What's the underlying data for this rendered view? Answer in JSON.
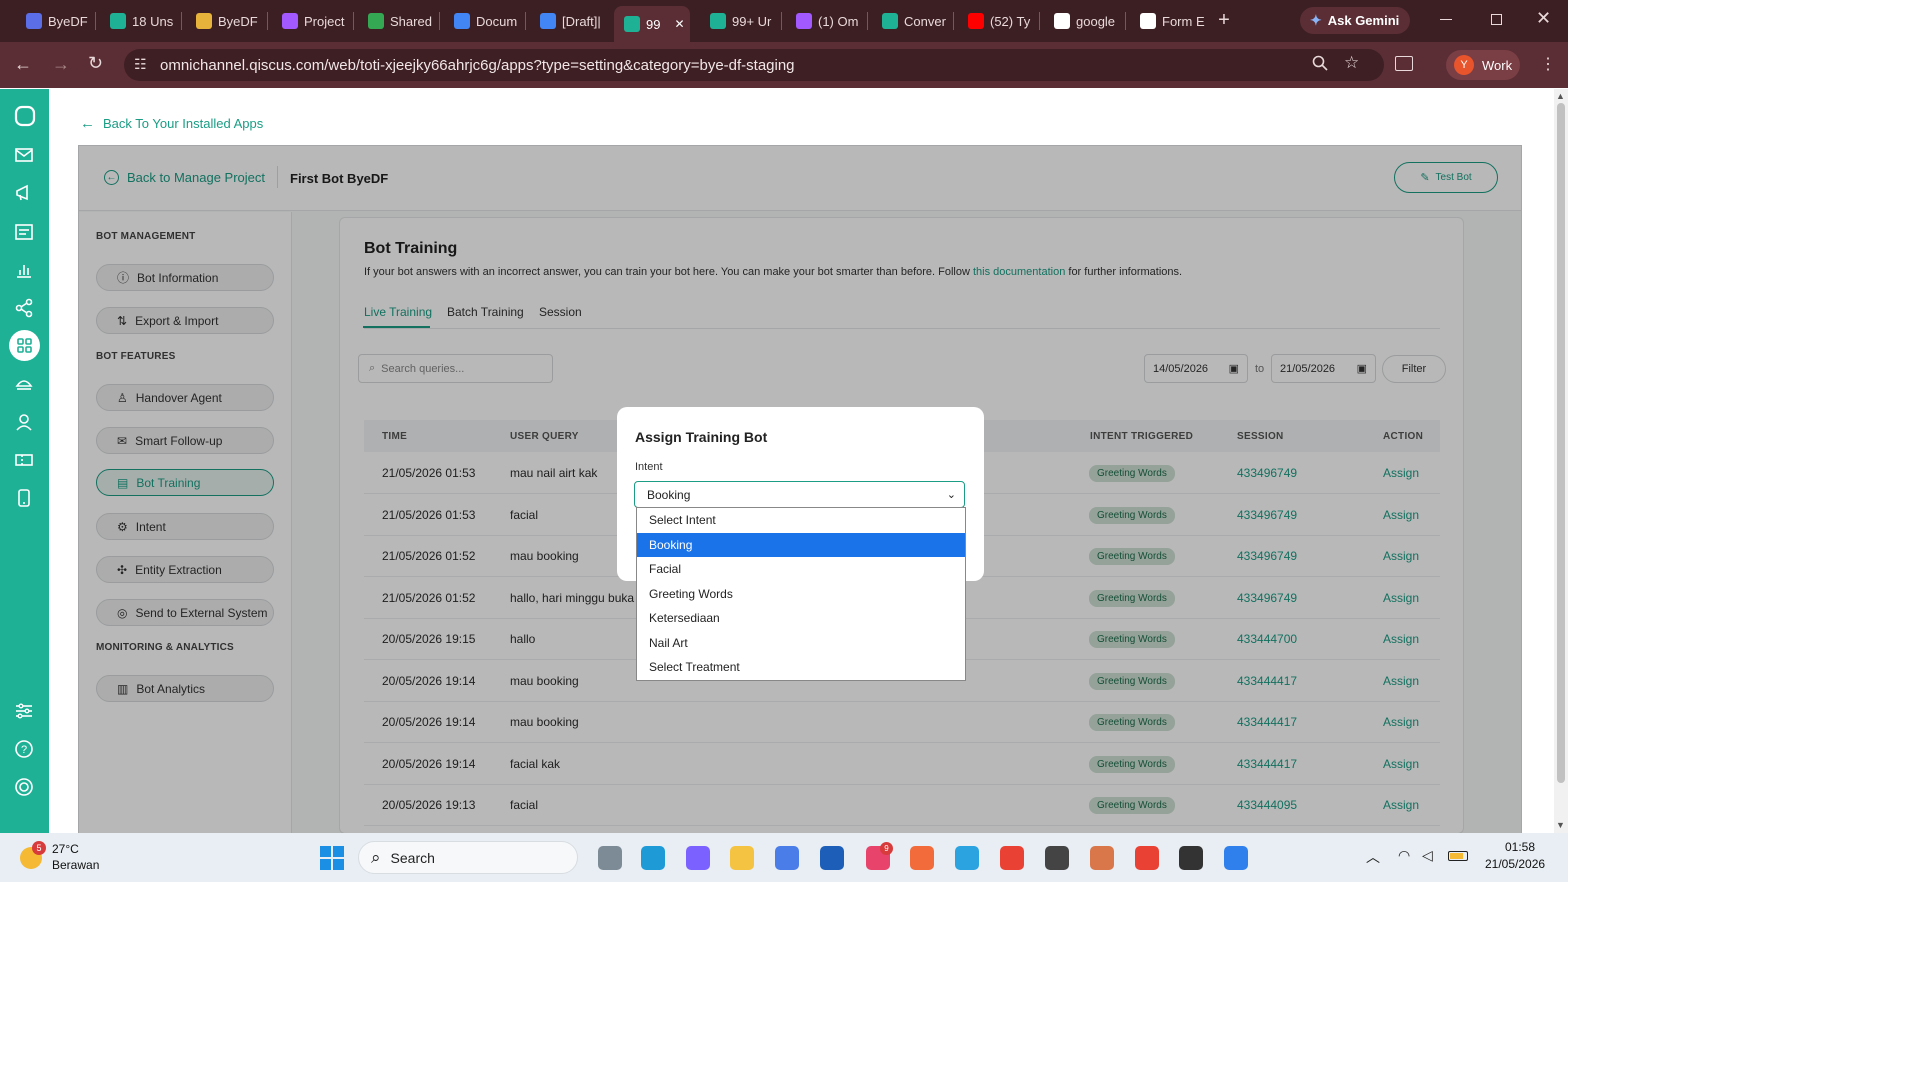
{
  "browser": {
    "tabs": [
      {
        "label": "ByeDF",
        "color": "#5b6ee8"
      },
      {
        "label": "18 Uns",
        "color": "#1fb196"
      },
      {
        "label": "ByeDF",
        "color": "#e8b33a"
      },
      {
        "label": "Project",
        "color": "#a259ff"
      },
      {
        "label": "Shared",
        "color": "#34a853"
      },
      {
        "label": "Docum",
        "color": "#4285f4"
      },
      {
        "label": "[Draft]|",
        "color": "#4285f4"
      },
      {
        "label": "99",
        "color": "#1fb196"
      },
      {
        "label": "99+ Ur",
        "color": "#1fb196"
      },
      {
        "label": "(1) Om",
        "color": "#a259ff"
      },
      {
        "label": "Conver",
        "color": "#1fb196"
      },
      {
        "label": "(52) Ty",
        "color": "#ff0000"
      },
      {
        "label": "google",
        "color": "#ffffff"
      },
      {
        "label": "Form E",
        "color": "#ffffff"
      }
    ],
    "ask_gemini": "Ask Gemini",
    "url": "omnichannel.qiscus.com/web/toti-xjeejky66ahrjc6g/apps?type=setting&category=bye-df-staging",
    "profile_initial": "Y",
    "profile_label": "Work"
  },
  "page": {
    "back_installed": "Back To Your Installed Apps",
    "back_manage": "Back to Manage Project",
    "bot_name": "First Bot ByeDF",
    "test_bot": "Test Bot"
  },
  "sidebar": {
    "heading_management": "BOT MANAGEMENT",
    "heading_features": "BOT FEATURES",
    "heading_monitoring": "MONITORING & ANALYTICS",
    "items": {
      "bot_information": "Bot Information",
      "export_import": "Export & Import",
      "handover_agent": "Handover Agent",
      "smart_followup": "Smart Follow-up",
      "bot_training": "Bot Training",
      "intent": "Intent",
      "entity_extraction": "Entity Extraction",
      "send_external": "Send to External System",
      "bot_analytics": "Bot Analytics"
    }
  },
  "training": {
    "title": "Bot Training",
    "desc_before": "If your bot answers with an incorrect answer, you can train your bot here. You can make your bot smarter than before. Follow ",
    "desc_link": "this documentation",
    "desc_after": " for further informations.",
    "tabs": [
      "Live Training",
      "Batch Training",
      "Session"
    ],
    "search_placeholder": "Search queries...",
    "date_from": "14/05/2026",
    "date_to": "21/05/2026",
    "to_label": "to",
    "filter": "Filter",
    "columns": {
      "time": "TIME",
      "query": "USER QUERY",
      "intent": "INTENT TRIGGERED",
      "session": "SESSION",
      "action": "ACTION"
    },
    "rows": [
      {
        "time": "21/05/2026 01:53",
        "query": "mau nail airt kak",
        "intent": "Greeting Words",
        "session": "433496749",
        "action": "Assign"
      },
      {
        "time": "21/05/2026 01:53",
        "query": "facial",
        "intent": "Greeting Words",
        "session": "433496749",
        "action": "Assign"
      },
      {
        "time": "21/05/2026 01:52",
        "query": "mau booking",
        "intent": "Greeting Words",
        "session": "433496749",
        "action": "Assign"
      },
      {
        "time": "21/05/2026 01:52",
        "query": "hallo, hari minggu buka g",
        "intent": "Greeting Words",
        "session": "433496749",
        "action": "Assign"
      },
      {
        "time": "20/05/2026 19:15",
        "query": "hallo",
        "intent": "Greeting Words",
        "session": "433444700",
        "action": "Assign"
      },
      {
        "time": "20/05/2026 19:14",
        "query": "mau booking",
        "intent": "Greeting Words",
        "session": "433444417",
        "action": "Assign"
      },
      {
        "time": "20/05/2026 19:14",
        "query": "mau booking",
        "intent": "Greeting Words",
        "session": "433444417",
        "action": "Assign"
      },
      {
        "time": "20/05/2026 19:14",
        "query": "facial kak",
        "intent": "Greeting Words",
        "session": "433444417",
        "action": "Assign"
      },
      {
        "time": "20/05/2026 19:13",
        "query": "facial",
        "intent": "Greeting Words",
        "session": "433444095",
        "action": "Assign"
      }
    ]
  },
  "modal": {
    "title": "Assign Training Bot",
    "intent_label": "Intent",
    "selected": "Booking",
    "options": [
      "Select Intent",
      "Booking",
      "Facial",
      "Greeting Words",
      "Ketersediaan",
      "Nail Art",
      "Select Treatment"
    ]
  },
  "taskbar": {
    "temp": "27°C",
    "weather": "Berawan",
    "weather_badge": "5",
    "search": "Search",
    "time": "01:58",
    "date": "21/05/2026",
    "slack_badge": "9"
  },
  "colors": {
    "accent": "#1a9d84",
    "rail": "#1fb196",
    "browser_dark": "#3c1f23",
    "browser_mid": "#5a2e34"
  }
}
